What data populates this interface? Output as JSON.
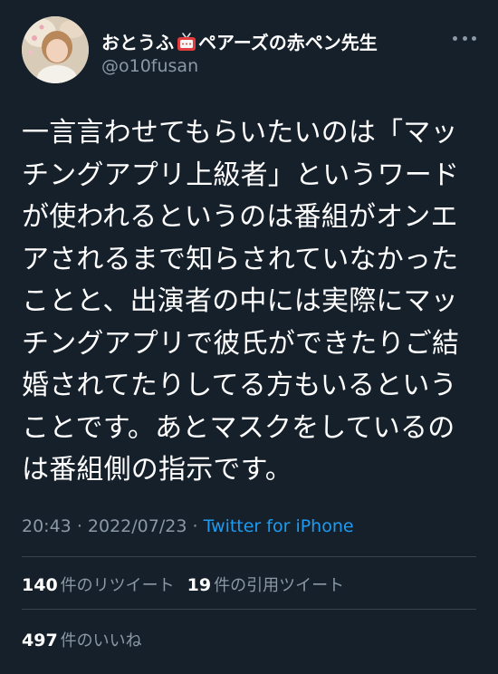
{
  "author": {
    "display_name_prefix": "おとうふ",
    "badge_icon": "tv-icon",
    "display_name_suffix": "ペアーズの赤ペン先生",
    "handle": "@o10fusan"
  },
  "tweet": {
    "lines": [
      "一言言わせてもらいたいのは「マッ",
      "チングアプリ上級者」というワード",
      "が使われるというのは番組がオンエ",
      "アされるまで知らされていなかった",
      "ことと、出演者の中には実際にマッ",
      "チングアプリで彼氏ができたりご結",
      "婚されてたりしてる方もいるという",
      "ことです。あとマスクをしているの",
      "は番組側の指示です。"
    ],
    "time": "20:43",
    "separator": "·",
    "date": "2022/07/23",
    "source": "Twitter for iPhone"
  },
  "stats": {
    "retweets_count": "140",
    "retweets_label": "件のリツイート",
    "quotes_count": "19",
    "quotes_label": "件の引用ツイート",
    "likes_count": "497",
    "likes_label": "件のいいね"
  },
  "colors": {
    "background": "#15202b",
    "text": "#ffffff",
    "secondary": "#8b98a5",
    "link": "#1d9bf0",
    "divider": "#38444d"
  }
}
